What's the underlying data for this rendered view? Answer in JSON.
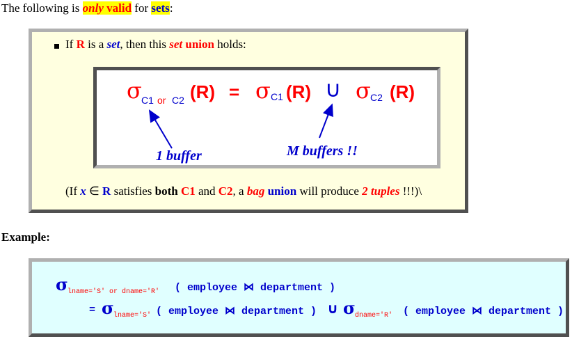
{
  "intro": {
    "prefix": "The following is ",
    "only": "only",
    "valid": " valid",
    "for": " for ",
    "sets": "sets",
    "colon": ":"
  },
  "rule_box": {
    "bullet": {
      "if": "If ",
      "R": "R",
      "is_a": " is a ",
      "set": "set",
      "then": ", then this ",
      "set2": "set",
      "union": "union",
      "holds": " holds:"
    },
    "formula": {
      "sigma": "σ",
      "sub_c1": "C1",
      "sub_or": "or",
      "sub_c2": "C2",
      "paren_R": "(R)",
      "equals": "=",
      "union_symbol": "∪"
    },
    "annotation_left": "1 buffer",
    "annotation_right": "M buffers !!",
    "note": {
      "open": "(If ",
      "x": "x",
      "in": " ∈ ",
      "R": "R",
      "satisfies": " satisfies ",
      "both": "both",
      "C1": "C1",
      "and": " and ",
      "C2": "C2",
      "comma_a": ", a ",
      "bag": "bag",
      "union": "union",
      "will": " will produce ",
      "two_tuples": "2 tuples",
      "close": " !!!)\\"
    }
  },
  "example": {
    "label": "Example:",
    "line1": {
      "sigma": "σ",
      "sub": "lname='S' or dname='R'",
      "body": "( employee ⋈ department )"
    },
    "line2": {
      "equals": "=",
      "sigma": "σ",
      "sub1": "lname='S'",
      "body1": "( employee ⋈ department )",
      "union": "∪",
      "sub2": "dname='R'",
      "body2": "( employee ⋈ department )"
    }
  }
}
